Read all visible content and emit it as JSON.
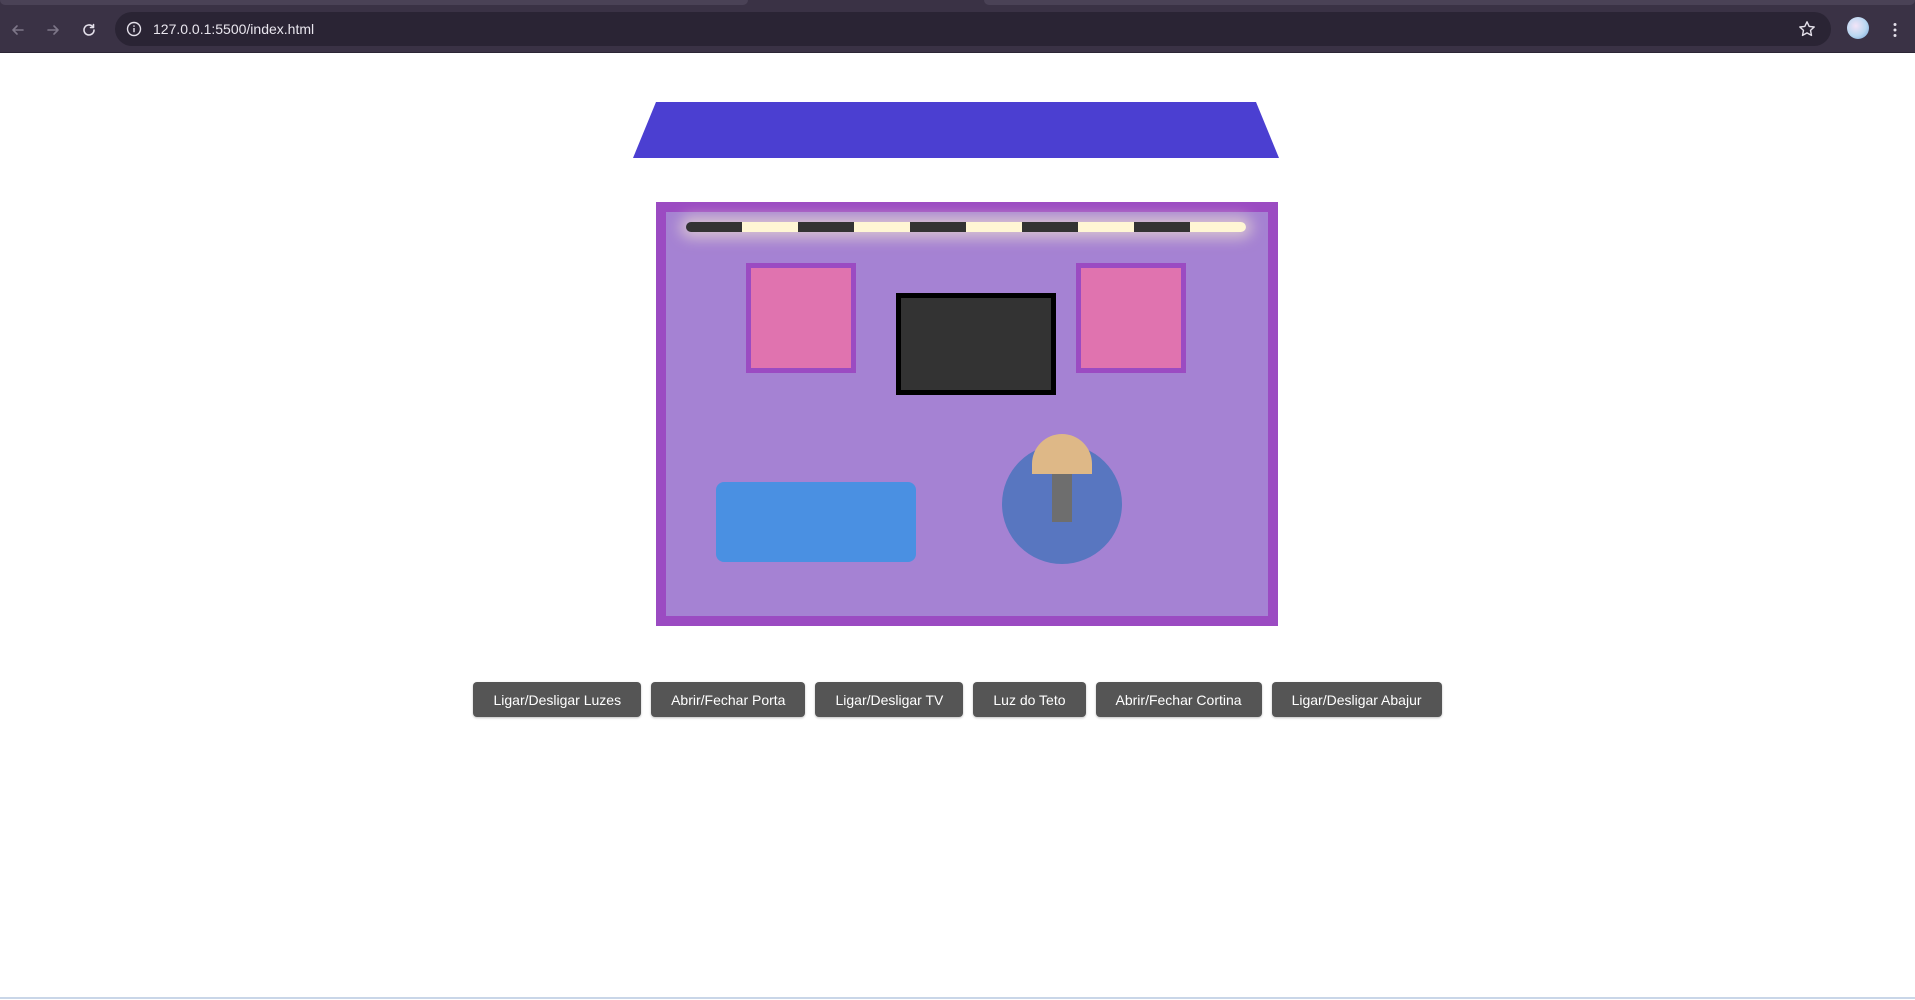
{
  "browser": {
    "url": "127.0.0.1:5500/index.html",
    "icons": {
      "back": "arrow-left-icon",
      "forward": "arrow-right-icon",
      "reload": "reload-icon",
      "site_info": "info-icon",
      "bookmark": "star-icon",
      "menu": "kebab-menu-icon"
    }
  },
  "scene": {
    "colors": {
      "roof": "#4b3fd1",
      "room": "#a582d3",
      "room_border": "#9b4bc2",
      "windows": "#e073af",
      "tv": "#333333",
      "sofa": "#4a90e2",
      "lamp_shade": "#deb887",
      "lamp_glow": "#5876c0",
      "light_on": "#fff6d4"
    },
    "light_strip_pattern": [
      "off",
      "on",
      "off",
      "on",
      "off",
      "on",
      "off",
      "on",
      "off",
      "on"
    ]
  },
  "controls": {
    "lights": "Ligar/Desligar Luzes",
    "door": "Abrir/Fechar Porta",
    "tv": "Ligar/Desligar TV",
    "ceiling_light": "Luz do Teto",
    "curtain": "Abrir/Fechar Cortina",
    "lamp": "Ligar/Desligar Abajur"
  }
}
